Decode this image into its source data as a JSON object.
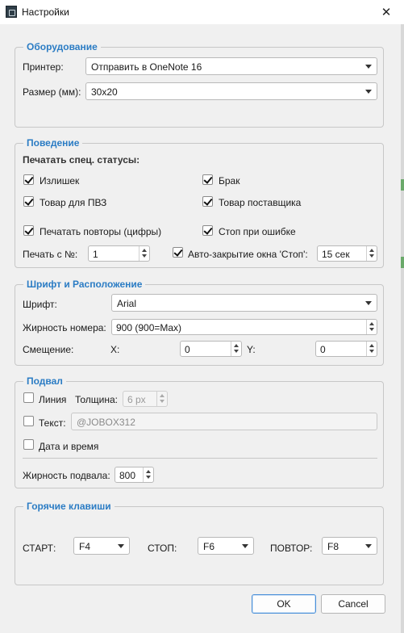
{
  "window": {
    "title": "Настройки"
  },
  "hardware": {
    "legend": "Оборудование",
    "printer_label": "Принтер:",
    "printer_value": "Отправить в OneNote 16",
    "size_label": "Размер (мм):",
    "size_value": "30x20"
  },
  "behavior": {
    "legend": "Поведение",
    "special_statuses_label": "Печатать спец. статусы:",
    "surplus": {
      "label": "Излишек",
      "checked": true
    },
    "defect": {
      "label": "Брак",
      "checked": true
    },
    "pvz_item": {
      "label": "Товар для ПВЗ",
      "checked": true
    },
    "supplier_item": {
      "label": "Товар поставщика",
      "checked": true
    },
    "print_repeats": {
      "label": "Печатать повторы (цифры)",
      "checked": true
    },
    "stop_on_error": {
      "label": "Стоп при ошибке",
      "checked": true
    },
    "print_from_label": "Печать с №:",
    "print_from_value": "1",
    "autoclose": {
      "label": "Авто-закрытие окна 'Стоп':",
      "checked": true
    },
    "autoclose_value": "15 сек"
  },
  "font": {
    "legend": "Шрифт и Расположение",
    "font_label": "Шрифт:",
    "font_value": "Arial",
    "weight_label": "Жирность номера:",
    "weight_value": "900 (900=Max)",
    "offset_label": "Смещение:",
    "x_label": "X:",
    "x_value": "0",
    "y_label": "Y:",
    "y_value": "0"
  },
  "footer": {
    "legend": "Подвал",
    "line": {
      "label": "Линия",
      "checked": false
    },
    "thickness_label": "Толщина:",
    "thickness_value": "6 px",
    "text": {
      "label": "Текст:",
      "checked": false
    },
    "text_placeholder": "@JOBOX312",
    "datetime": {
      "label": "Дата и время",
      "checked": false
    },
    "weight_label": "Жирность подвала:",
    "weight_value": "800"
  },
  "hotkeys": {
    "legend": "Горячие клавиши",
    "start_label": "СТАРТ:",
    "start_value": "F4",
    "stop_label": "СТОП:",
    "stop_value": "F6",
    "repeat_label": "ПОВТОР:",
    "repeat_value": "F8"
  },
  "buttons": {
    "ok": "OK",
    "cancel": "Cancel"
  },
  "icons": {
    "app": "app-icon",
    "close": "close-icon",
    "dropdown": "chevron-down-icon",
    "spin": "spin-arrows-icon",
    "check": "checkmark-icon"
  },
  "colors": {
    "legend": "#2b7cc4",
    "background": "#f0f0f0",
    "default_button_border": "#4a90d9"
  }
}
